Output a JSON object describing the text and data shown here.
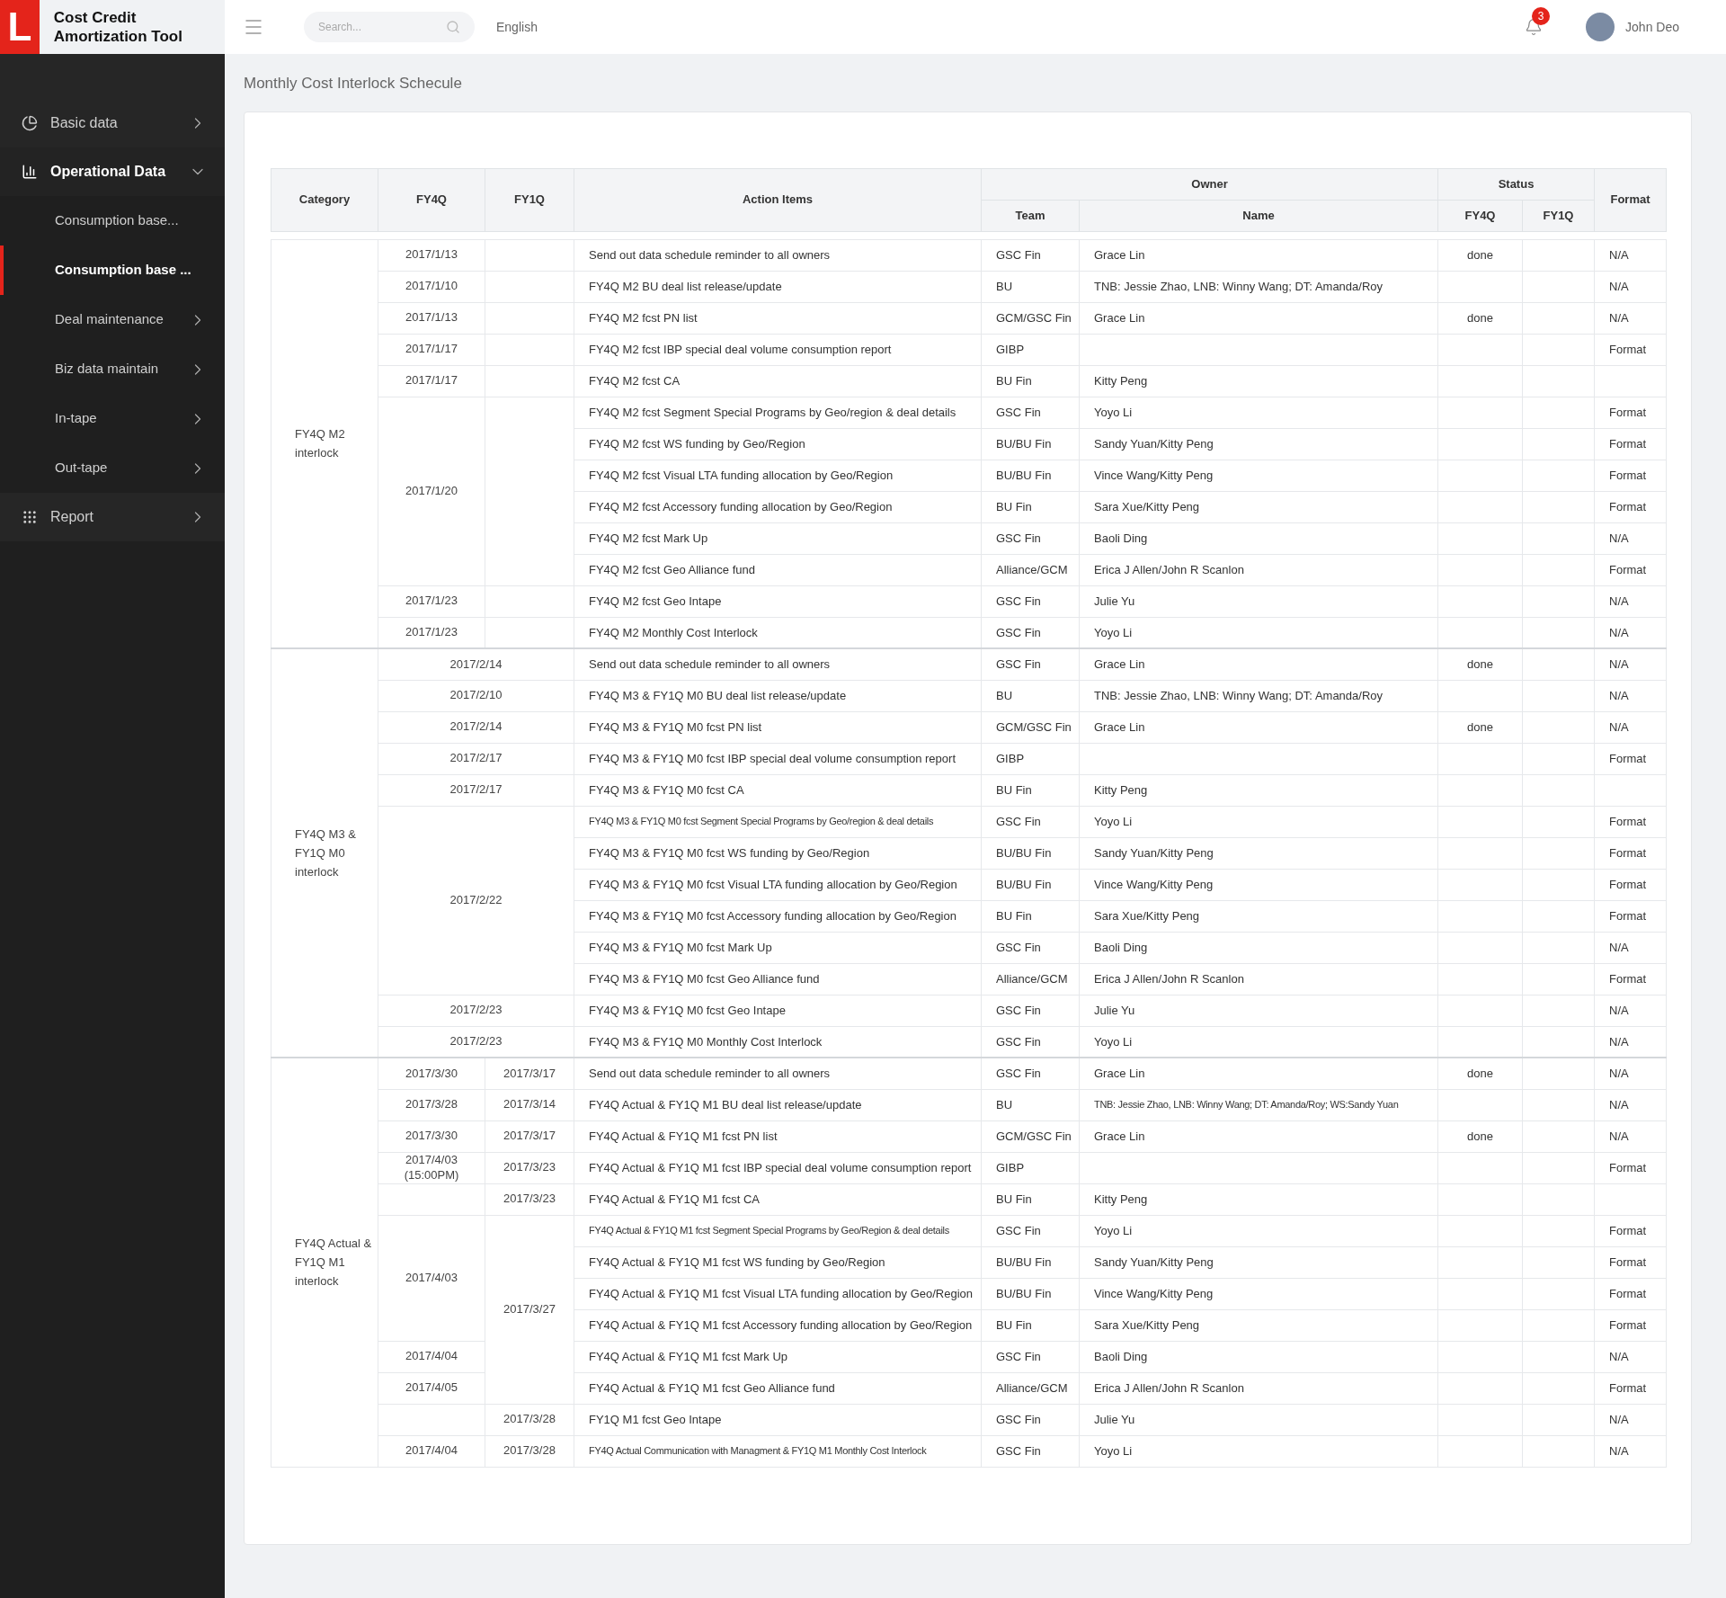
{
  "app": {
    "logo_letter": "L",
    "title": "Cost Credit Amortization Tool"
  },
  "header": {
    "search": {
      "placeholder": "Search..."
    },
    "language": "English",
    "notifications": "3",
    "user": "John Deo"
  },
  "sidebar": {
    "items": [
      {
        "label": "Basic data",
        "selected": false,
        "expanded": false
      },
      {
        "label": "Operational Data",
        "selected": true,
        "expanded": true,
        "children": [
          {
            "label": "Consumption base...",
            "kind": "page",
            "selected": false
          },
          {
            "label": "Consumption base ...",
            "kind": "page",
            "selected": true
          },
          {
            "label": "Deal maintenance",
            "kind": "folder",
            "selected": false,
            "expanded": false
          },
          {
            "label": "Biz data maintain",
            "kind": "folder",
            "selected": false,
            "expanded": false
          },
          {
            "label": "In-tape",
            "kind": "folder",
            "selected": false,
            "expanded": false
          },
          {
            "label": "Out-tape",
            "kind": "folder",
            "selected": false,
            "expanded": false
          }
        ]
      },
      {
        "label": "Report",
        "selected": false,
        "expanded": false
      }
    ]
  },
  "page_title": "Monthly Cost Interlock Schecule",
  "table": {
    "columns": {
      "category": "Category",
      "fy4q": "FY4Q",
      "fy1q": "FY1Q",
      "action": "Action Items",
      "owner": "Owner",
      "team": "Team",
      "name": "Name",
      "status": "Status",
      "status_fy4q": "FY4Q",
      "status_fy1q": "FY1Q",
      "format": "Format"
    },
    "groups": [
      {
        "category": "FY4Q M2 interlock",
        "dates_merged": false,
        "rows": [
          {
            "fy4q": "2017/1/13",
            "action": "Send out data schedule reminder to all owners",
            "team": "GSC Fin",
            "name": "Grace Lin",
            "status_fy4q": "done",
            "format": "N/A"
          },
          {
            "fy4q": "2017/1/10",
            "action": "FY4Q M2 BU deal list release/update",
            "team": "BU",
            "name": "TNB: Jessie Zhao, LNB: Winny Wang; DT: Amanda/Roy",
            "format": "N/A"
          },
          {
            "fy4q": "2017/1/13",
            "action": "FY4Q M2 fcst PN list",
            "team": "GCM/GSC Fin",
            "name": "Grace Lin",
            "status_fy4q": "done",
            "format": "N/A"
          },
          {
            "fy4q": "2017/1/17",
            "action": "FY4Q M2 fcst IBP special deal volume consumption report",
            "team": "GIBP",
            "format": "Format"
          },
          {
            "fy4q": "2017/1/17",
            "action": "FY4Q M2 fcst CA",
            "team": "BU Fin",
            "name": "Kitty Peng"
          },
          {
            "fy4q": "2017/1/20",
            "action": "FY4Q M2 fcst Segment Special Programs by Geo/region & deal details",
            "team": "GSC Fin",
            "name": "Yoyo Li",
            "format": "Format"
          },
          {
            "fy4q_continued": true,
            "fy1q_continued": true,
            "action": "FY4Q M2 fcst WS funding by Geo/Region",
            "team": "BU/BU Fin",
            "name": "Sandy Yuan/Kitty Peng",
            "format": "Format"
          },
          {
            "fy4q_continued": true,
            "fy1q_continued": true,
            "action": "FY4Q M2 fcst Visual LTA funding allocation by Geo/Region",
            "team": "BU/BU Fin",
            "name": "Vince Wang/Kitty Peng",
            "format": "Format"
          },
          {
            "fy4q_continued": true,
            "fy1q_continued": true,
            "action": "FY4Q M2 fcst Accessory funding allocation by Geo/Region",
            "team": "BU Fin",
            "name": "Sara Xue/Kitty Peng",
            "format": "Format"
          },
          {
            "fy4q_continued": true,
            "fy1q_continued": true,
            "action": "FY4Q M2 fcst Mark Up",
            "team": "GSC Fin",
            "name": "Baoli Ding",
            "format": "N/A"
          },
          {
            "fy4q_continued": true,
            "fy1q_continued": true,
            "action": "FY4Q M2 fcst Geo Alliance fund",
            "team": "Alliance/GCM",
            "name": "Erica J Allen/John R Scanlon",
            "format": "Format"
          },
          {
            "fy4q": "2017/1/23",
            "action": "FY4Q M2 fcst Geo Intape",
            "team": "GSC Fin",
            "name": "Julie Yu",
            "format": "N/A"
          },
          {
            "fy4q": "2017/1/23",
            "action": "FY4Q M2 Monthly Cost Interlock",
            "team": "GSC Fin",
            "name": "Yoyo Li",
            "format": "N/A"
          }
        ]
      },
      {
        "category": "FY4Q M3 & FY1Q M0 interlock",
        "dates_merged": true,
        "rows": [
          {
            "fy4q": "2017/2/14",
            "action": "Send out data schedule reminder to all owners",
            "team": "GSC Fin",
            "name": "Grace Lin",
            "status_fy4q": "done",
            "format": "N/A"
          },
          {
            "fy4q": "2017/2/10",
            "action": "FY4Q M3 & FY1Q M0 BU deal list release/update",
            "team": "BU",
            "name": "TNB: Jessie Zhao, LNB: Winny Wang; DT: Amanda/Roy",
            "format": "N/A"
          },
          {
            "fy4q": "2017/2/14",
            "action": "FY4Q M3 & FY1Q M0 fcst PN list",
            "team": "GCM/GSC Fin",
            "name": "Grace Lin",
            "status_fy4q": "done",
            "format": "N/A"
          },
          {
            "fy4q": "2017/2/17",
            "action": "FY4Q M3 & FY1Q M0 fcst IBP special deal volume consumption report",
            "team": "GIBP",
            "format": "Format"
          },
          {
            "fy4q": "2017/2/17",
            "action": "FY4Q M3 & FY1Q M0 fcst CA",
            "team": "BU Fin",
            "name": "Kitty Peng"
          },
          {
            "fy4q": "2017/2/22",
            "action": "FY4Q M3 & FY1Q M0 fcst Segment Special Programs by Geo/region & deal details",
            "team": "GSC Fin",
            "name": "Yoyo Li",
            "format": "Format"
          },
          {
            "fy4q_continued": true,
            "action": "FY4Q M3 & FY1Q M0 fcst WS funding by Geo/Region",
            "team": "BU/BU Fin",
            "name": "Sandy Yuan/Kitty Peng",
            "format": "Format"
          },
          {
            "fy4q_continued": true,
            "action": "FY4Q M3 & FY1Q M0 fcst Visual LTA funding allocation by Geo/Region",
            "team": "BU/BU Fin",
            "name": "Vince Wang/Kitty Peng",
            "format": "Format"
          },
          {
            "fy4q_continued": true,
            "action": "FY4Q M3 & FY1Q M0 fcst Accessory funding allocation by Geo/Region",
            "team": "BU Fin",
            "name": "Sara Xue/Kitty Peng",
            "format": "Format"
          },
          {
            "fy4q_continued": true,
            "action": "FY4Q M3 & FY1Q M0 fcst Mark Up",
            "team": "GSC Fin",
            "name": "Baoli Ding",
            "format": "N/A"
          },
          {
            "fy4q_continued": true,
            "action": "FY4Q M3 & FY1Q M0 fcst Geo Alliance fund",
            "team": "Alliance/GCM",
            "name": "Erica J Allen/John R Scanlon",
            "format": "Format"
          },
          {
            "fy4q": "2017/2/23",
            "action": "FY4Q M3 & FY1Q M0 fcst Geo Intape",
            "team": "GSC Fin",
            "name": "Julie Yu",
            "format": "N/A"
          },
          {
            "fy4q": "2017/2/23",
            "action": "FY4Q M3 & FY1Q M0 Monthly Cost Interlock",
            "team": "GSC Fin",
            "name": "Yoyo Li",
            "format": "N/A"
          }
        ]
      },
      {
        "category": "FY4Q Actual & FY1Q M1 interlock",
        "dates_merged": false,
        "rows": [
          {
            "fy4q": "2017/3/30",
            "fy1q": "2017/3/17",
            "action": "Send out data schedule reminder to all owners",
            "team": "GSC Fin",
            "name": "Grace Lin",
            "status_fy4q": "done",
            "format": "N/A"
          },
          {
            "fy4q": "2017/3/28",
            "fy1q": "2017/3/14",
            "action": "FY4Q Actual & FY1Q M1 BU deal list release/update",
            "team": "BU",
            "name": "TNB: Jessie Zhao, LNB: Winny Wang; DT: Amanda/Roy; WS:Sandy Yuan",
            "format": "N/A"
          },
          {
            "fy4q": "2017/3/30",
            "fy1q": "2017/3/17",
            "action": "FY4Q Actual & FY1Q M1 fcst PN list",
            "team": "GCM/GSC Fin",
            "name": "Grace Lin",
            "status_fy4q": "done",
            "format": "N/A"
          },
          {
            "fy4q": "2017/4/03 (15:00PM)",
            "fy1q": "2017/3/23",
            "action": "FY4Q Actual & FY1Q M1 fcst IBP special deal volume consumption report",
            "team": "GIBP",
            "format": "Format"
          },
          {
            "fy1q": "2017/3/23",
            "action": "FY4Q Actual & FY1Q M1 fcst CA",
            "team": "BU Fin",
            "name": "Kitty Peng"
          },
          {
            "fy4q": "2017/4/03",
            "fy1q": "2017/3/27",
            "action": "FY4Q Actual & FY1Q M1 fcst Segment Special Programs by Geo/Region & deal details",
            "team": "GSC Fin",
            "name": "Yoyo Li",
            "format": "Format"
          },
          {
            "fy4q_continued": true,
            "fy1q_continued": true,
            "action": "FY4Q Actual & FY1Q M1 fcst WS funding by Geo/Region",
            "team": "BU/BU Fin",
            "name": "Sandy Yuan/Kitty Peng",
            "format": "Format"
          },
          {
            "fy4q_continued": true,
            "fy1q_continued": true,
            "action": "FY4Q Actual & FY1Q M1 fcst Visual LTA funding allocation by Geo/Region",
            "team": "BU/BU Fin",
            "name": "Vince Wang/Kitty Peng",
            "format": "Format"
          },
          {
            "fy4q_continued": true,
            "fy1q_continued": true,
            "action": "FY4Q Actual & FY1Q M1 fcst Accessory funding allocation by Geo/Region",
            "team": "BU Fin",
            "name": "Sara Xue/Kitty Peng",
            "format": "Format"
          },
          {
            "fy4q": "2017/4/04",
            "fy1q_continued": true,
            "action": "FY4Q Actual & FY1Q M1 fcst Mark Up",
            "team": "GSC Fin",
            "name": "Baoli Ding",
            "format": "N/A"
          },
          {
            "fy4q": "2017/4/05",
            "fy1q_continued": true,
            "action": "FY4Q Actual & FY1Q M1 fcst Geo Alliance fund",
            "team": "Alliance/GCM",
            "name": "Erica J Allen/John R Scanlon",
            "format": "Format"
          },
          {
            "fy1q": "2017/3/28",
            "action": "FY1Q M1 fcst Geo Intape",
            "team": "GSC Fin",
            "name": "Julie Yu",
            "format": "N/A"
          },
          {
            "fy4q": "2017/4/04",
            "fy1q": "2017/3/28",
            "action": "FY4Q Actual Communication with Managment & FY1Q M1 Monthly Cost Interlock",
            "team": "GSC Fin",
            "name": "Yoyo Li",
            "format": "N/A"
          }
        ]
      }
    ]
  }
}
